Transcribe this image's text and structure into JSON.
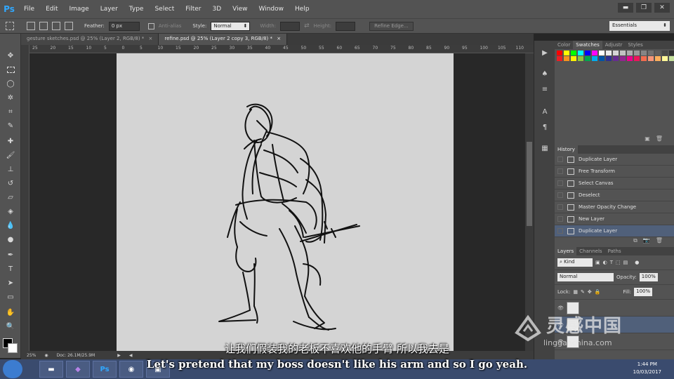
{
  "app": {
    "logo": "Ps"
  },
  "menu": [
    "File",
    "Edit",
    "Image",
    "Layer",
    "Type",
    "Select",
    "Filter",
    "3D",
    "View",
    "Window",
    "Help"
  ],
  "window_controls": [
    "▬",
    "❐",
    "✕"
  ],
  "options": {
    "feather_label": "Feather:",
    "feather_value": "0 px",
    "antialias_label": "Anti-alias",
    "style_label": "Style:",
    "style_value": "Normal",
    "width_label": "Width:",
    "height_label": "Height:",
    "refine_edge": "Refine Edge...",
    "workspace": "Essentials"
  },
  "tabs": [
    {
      "label": "gesture sketches.psd @ 25% (Layer 2, RGB/8) *",
      "active": false
    },
    {
      "label": "refine.psd @ 25% (Layer 2 copy 3, RGB/8) *",
      "active": true
    }
  ],
  "ruler_numbers": [
    "25",
    "20",
    "15",
    "10",
    "5",
    "0",
    "5",
    "10",
    "15",
    "20",
    "25",
    "30",
    "35",
    "40",
    "45",
    "50",
    "55",
    "60",
    "65",
    "70",
    "75",
    "80",
    "85",
    "90",
    "95",
    "100",
    "105",
    "110"
  ],
  "status": {
    "zoom": "25%",
    "doc": "Doc: 26.1M/25.9M"
  },
  "swatches_panel": {
    "tabs": [
      "Color",
      "Swatches",
      "Adjustr",
      "Styles"
    ],
    "active_tab": "Swatches",
    "colors": [
      "#ff0000",
      "#ffff00",
      "#00ff00",
      "#00ffff",
      "#0000ff",
      "#ff00ff",
      "#ffffff",
      "#ebebeb",
      "#d6d6d6",
      "#c2c2c2",
      "#adadad",
      "#999999",
      "#858585",
      "#707070",
      "#5c5c5c",
      "#474747",
      "#333333",
      "#ed1c24",
      "#f7941d",
      "#fff200",
      "#8dc63f",
      "#00a651",
      "#00aeef",
      "#0054a6",
      "#2e3192",
      "#662d91",
      "#92278f",
      "#ec008c",
      "#ed145b",
      "#f26c4f",
      "#f69679",
      "#fbaf5d",
      "#fff799",
      "#c4df9b"
    ]
  },
  "history_panel": {
    "title": "History",
    "items": [
      {
        "label": "Duplicate Layer",
        "active": false
      },
      {
        "label": "Free Transform",
        "active": false
      },
      {
        "label": "Select Canvas",
        "active": false
      },
      {
        "label": "Deselect",
        "active": false
      },
      {
        "label": "Master Opacity Change",
        "active": false
      },
      {
        "label": "New Layer",
        "active": false
      },
      {
        "label": "Duplicate Layer",
        "active": true
      }
    ]
  },
  "layers_panel": {
    "tabs": [
      "Layers",
      "Channels",
      "Paths"
    ],
    "active_tab": "Layers",
    "kind": "Kind",
    "blend_mode": "Normal",
    "opacity_label": "Opacity:",
    "opacity": "100%",
    "lock_label": "Lock:",
    "fill_label": "Fill:",
    "fill": "100%"
  },
  "subtitles": {
    "cn": "让我们假装我的老板不喜欢他的手臂 所以我去是",
    "en": "Let's pretend that my boss doesn't like his arm and so I go yeah."
  },
  "watermark": {
    "cn": "灵感中国",
    "url": "lingganchina.com"
  },
  "taskbar": {
    "apps": [
      "folder",
      "VS",
      "Ps",
      "chrome",
      "app"
    ],
    "time": "1:44 PM",
    "date": "10/03/2017"
  }
}
